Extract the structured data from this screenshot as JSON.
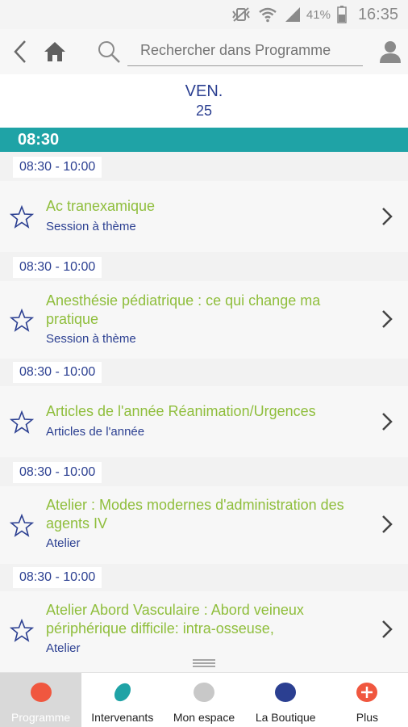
{
  "status_bar": {
    "battery": "41%",
    "time": "16:35"
  },
  "top_bar": {
    "search_placeholder": "Rechercher dans Programme"
  },
  "day": {
    "name": "VEN.",
    "number": "25"
  },
  "time_band": "08:30",
  "sessions": [
    {
      "slot": "08:30 - 10:00",
      "title": "Ac tranexamique",
      "type": "Session à thème"
    },
    {
      "slot": "08:30 - 10:00",
      "title": "Anesthésie pédiatrique : ce qui change ma pratique",
      "type": "Session à thème"
    },
    {
      "slot": "08:30 - 10:00",
      "title": "Articles de l'année Réanimation/Urgences",
      "type": "Articles de l'année"
    },
    {
      "slot": "08:30 - 10:00",
      "title": "Atelier : Modes modernes d'administration des agents IV",
      "type": "Atelier"
    },
    {
      "slot": "08:30 - 10:00",
      "title": "Atelier Abord Vasculaire : Abord veineux périphérique difficile: intra-osseuse,",
      "type": "Atelier"
    }
  ],
  "bottom_nav": [
    {
      "label": "Programme",
      "color": "#f0573f"
    },
    {
      "label": "Intervenants",
      "color": "#1fa3a6"
    },
    {
      "label": "Mon espace",
      "color": "#c8c8c8"
    },
    {
      "label": "La Boutique",
      "color": "#2b3f91"
    },
    {
      "label": "Plus",
      "color": "#f0573f"
    }
  ],
  "colors": {
    "accent_teal": "#1fa3a6",
    "title_green": "#8fbe3c",
    "text_blue": "#2b3f91"
  },
  "icons": [
    "vibrate-icon",
    "wifi-icon",
    "signal-icon",
    "battery-icon",
    "back-icon",
    "home-icon",
    "search-icon",
    "profile-icon",
    "star-icon",
    "chevron-right-icon",
    "drag-handle-icon",
    "plus-icon"
  ]
}
